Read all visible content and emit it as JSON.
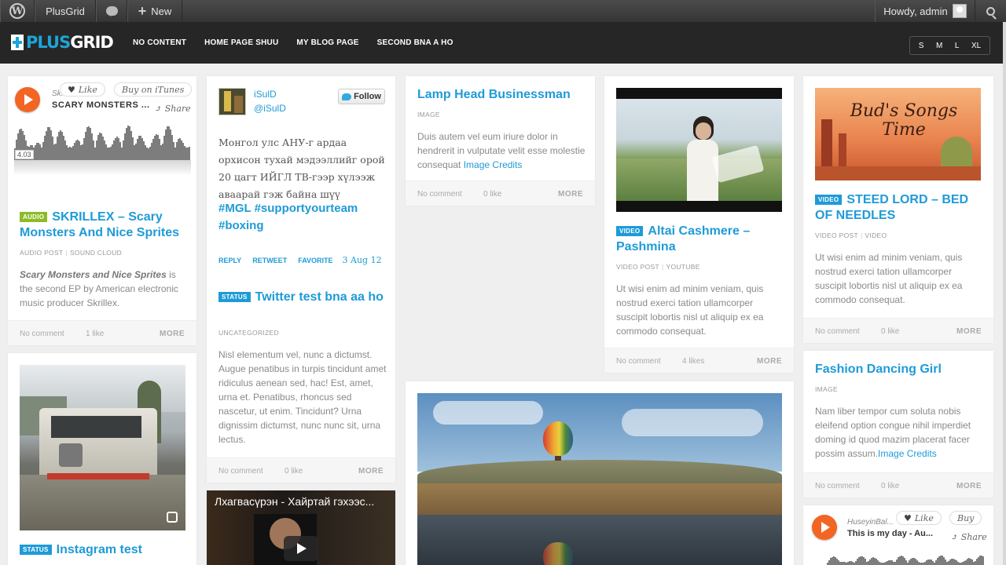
{
  "adminbar": {
    "site_name": "PlusGrid",
    "new_label": "New",
    "howdy": "Howdy, admin"
  },
  "header": {
    "logo_part1": "PLUS",
    "logo_part2": "GRID",
    "nav": [
      "NO CONTENT",
      "HOME PAGE SHUU",
      "MY BLOG PAGE",
      "SECOND BNA A HO"
    ],
    "sizes": [
      "S",
      "M",
      "L",
      "XL"
    ]
  },
  "cards": {
    "audio1": {
      "artist": "Sk...",
      "track": "SCARY MONSTERS ...",
      "like": "Like",
      "buy": "Buy on iTunes",
      "share": "Share",
      "time": "4.03",
      "badge": "AUDIO",
      "title": "SKRILLEX – Scary Monsters And Nice Sprites",
      "meta1": "AUDIO POST",
      "meta2": "SOUND CLOUD",
      "body_em": "Scary Monsters and Nice Sprites",
      "body": " is the second EP by American electronic music producer Skrillex.",
      "comments": "No comment",
      "likes": "1 like",
      "more": "MORE"
    },
    "twitter": {
      "name": "iSulD",
      "handle": "@iSulD",
      "follow": "Follow",
      "tweet": "Монгол улс АНУ-г ардаа орхисон тухай мэдээллийг орой 20 цагт ИЙГЛ ТВ-гээр хүлээж аваарай гэж байна шүү",
      "hashtags": "#MGL #supportyourteam #boxing",
      "reply": "REPLY",
      "retweet": "RETWEET",
      "favorite": "FAVORITE",
      "date": "3 Aug 12"
    },
    "status_twitter": {
      "badge": "STATUS",
      "title": "Twitter test bna aa ho",
      "meta": "UNCATEGORIZED",
      "body": "Nisl elementum vel, nunc a dictumst. Augue penatibus in turpis tincidunt amet ridiculus aenean sed, hac! Est, amet, urna et. Penatibus, rhoncus sed nascetur, ut enim. Tincidunt? Urna dignissim dictumst, nunc nunc sit, urna lectus.",
      "comments": "No comment",
      "likes": "0 like",
      "more": "MORE"
    },
    "video_mn": {
      "title": "Лхагвасүрэн - Хайртай гэхээс..."
    },
    "lamp": {
      "title": "Lamp Head Businessman",
      "meta": "IMAGE",
      "body": "Duis autem vel eum iriure dolor in hendrerit in vulputate velit esse molestie consequat ",
      "link": "Image Credits",
      "comments": "No comment",
      "likes": "0 like",
      "more": "MORE"
    },
    "altai": {
      "badge": "VIDEO",
      "title": "Altai Cashmere – Pashmina",
      "meta1": "VIDEO POST",
      "meta2": "YOUTUBE",
      "body": "Ut wisi enim ad minim veniam, quis nostrud exerci tation ullamcorper suscipit lobortis nisl ut aliquip ex ea commodo consequat.",
      "comments": "No comment",
      "likes": "4 likes",
      "more": "MORE"
    },
    "steed": {
      "art_text": "Bud's Songs Time",
      "badge": "VIDEO",
      "title": "STEED LORD – BED OF NEEDLES",
      "meta1": "VIDEO POST",
      "meta2": "VIDEO",
      "body": "Ut wisi enim ad minim veniam, quis nostrud exerci tation ullamcorper suscipit lobortis nisl ut aliquip ex ea commodo consequat.",
      "comments": "No comment",
      "likes": "0 like",
      "more": "MORE"
    },
    "fashion": {
      "title": "Fashion Dancing Girl",
      "meta": "IMAGE",
      "body": "Nam liber tempor cum soluta nobis eleifend option congue nihil imperdiet doming id quod mazim placerat facer possim assum.",
      "link": "Image Credits",
      "comments": "No comment",
      "likes": "0 like",
      "more": "MORE"
    },
    "audio2": {
      "artist": "HuseyinBal...",
      "track": "This is my day - Au...",
      "like": "Like",
      "buy": "Buy",
      "share": "Share"
    },
    "instagram": {
      "badge": "STATUS",
      "title": "Instagram test"
    }
  }
}
